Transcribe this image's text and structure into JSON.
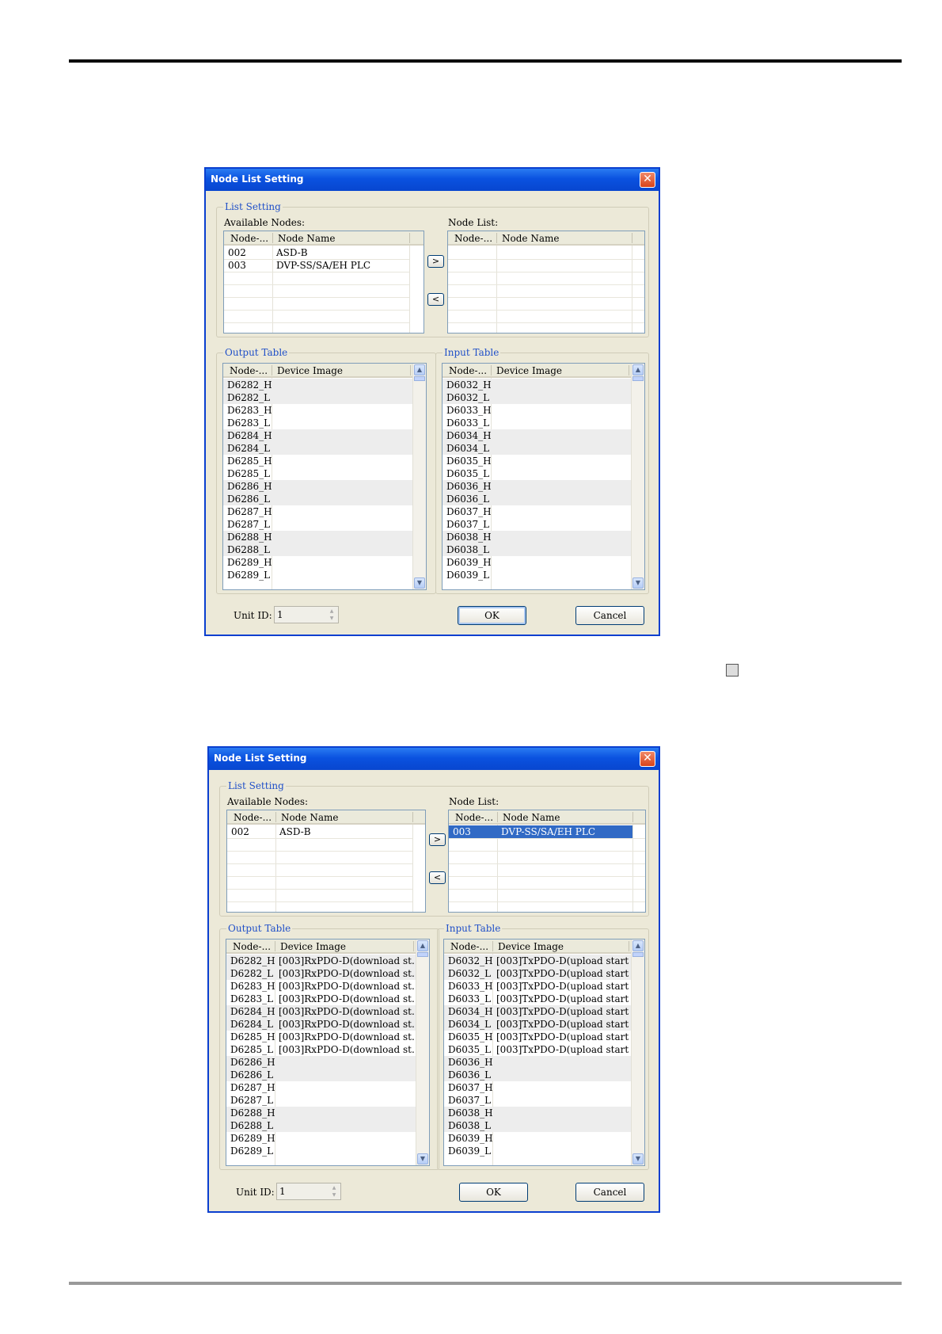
{
  "dialogs": [
    {
      "title": "Node List Setting",
      "group_list": "List Setting",
      "available_label": "Available Nodes:",
      "nodelist_label": "Node List:",
      "col_node": "Node-...",
      "col_name": "Node Name",
      "available_rows": [
        {
          "node": "002",
          "name": "ASD-B"
        },
        {
          "node": "003",
          "name": "DVP-SS/SA/EH PLC"
        }
      ],
      "node_list_rows": [],
      "move_right": ">",
      "move_left": "<",
      "output_table": {
        "label": "Output Table",
        "col_node": "Node-...",
        "col_image": "Device Image",
        "rows": [
          {
            "reg": "D6282_H",
            "image": ""
          },
          {
            "reg": "D6282_L",
            "image": ""
          },
          {
            "reg": "D6283_H",
            "image": ""
          },
          {
            "reg": "D6283_L",
            "image": ""
          },
          {
            "reg": "D6284_H",
            "image": ""
          },
          {
            "reg": "D6284_L",
            "image": ""
          },
          {
            "reg": "D6285_H",
            "image": ""
          },
          {
            "reg": "D6285_L",
            "image": ""
          },
          {
            "reg": "D6286_H",
            "image": ""
          },
          {
            "reg": "D6286_L",
            "image": ""
          },
          {
            "reg": "D6287_H",
            "image": ""
          },
          {
            "reg": "D6287_L",
            "image": ""
          },
          {
            "reg": "D6288_H",
            "image": ""
          },
          {
            "reg": "D6288_L",
            "image": ""
          },
          {
            "reg": "D6289_H",
            "image": ""
          },
          {
            "reg": "D6289_L",
            "image": ""
          }
        ]
      },
      "input_table": {
        "label": "Input Table",
        "col_node": "Node-...",
        "col_image": "Device Image",
        "rows": [
          {
            "reg": "D6032_H",
            "image": ""
          },
          {
            "reg": "D6032_L",
            "image": ""
          },
          {
            "reg": "D6033_H",
            "image": ""
          },
          {
            "reg": "D6033_L",
            "image": ""
          },
          {
            "reg": "D6034_H",
            "image": ""
          },
          {
            "reg": "D6034_L",
            "image": ""
          },
          {
            "reg": "D6035_H",
            "image": ""
          },
          {
            "reg": "D6035_L",
            "image": ""
          },
          {
            "reg": "D6036_H",
            "image": ""
          },
          {
            "reg": "D6036_L",
            "image": ""
          },
          {
            "reg": "D6037_H",
            "image": ""
          },
          {
            "reg": "D6037_L",
            "image": ""
          },
          {
            "reg": "D6038_H",
            "image": ""
          },
          {
            "reg": "D6038_L",
            "image": ""
          },
          {
            "reg": "D6039_H",
            "image": ""
          },
          {
            "reg": "D6039_L",
            "image": ""
          }
        ]
      },
      "unit_id_label": "Unit ID:",
      "unit_id_value": "1",
      "ok_label": "OK",
      "cancel_label": "Cancel"
    },
    {
      "title": "Node List Setting",
      "group_list": "List Setting",
      "available_label": "Available Nodes:",
      "nodelist_label": "Node List:",
      "col_node": "Node-...",
      "col_name": "Node Name",
      "available_rows": [
        {
          "node": "002",
          "name": "ASD-B"
        }
      ],
      "node_list_rows": [
        {
          "node": "003",
          "name": "DVP-SS/SA/EH PLC",
          "selected": true
        }
      ],
      "move_right": ">",
      "move_left": "<",
      "output_table": {
        "label": "Output Table",
        "col_node": "Node-...",
        "col_image": "Device Image",
        "rows": [
          {
            "reg": "D6282_H",
            "image": "[003]RxPDO-D(download st..."
          },
          {
            "reg": "D6282_L",
            "image": "[003]RxPDO-D(download st..."
          },
          {
            "reg": "D6283_H",
            "image": "[003]RxPDO-D(download st..."
          },
          {
            "reg": "D6283_L",
            "image": "[003]RxPDO-D(download st..."
          },
          {
            "reg": "D6284_H",
            "image": "[003]RxPDO-D(download st..."
          },
          {
            "reg": "D6284_L",
            "image": "[003]RxPDO-D(download st..."
          },
          {
            "reg": "D6285_H",
            "image": "[003]RxPDO-D(download st..."
          },
          {
            "reg": "D6285_L",
            "image": "[003]RxPDO-D(download st..."
          },
          {
            "reg": "D6286_H",
            "image": ""
          },
          {
            "reg": "D6286_L",
            "image": ""
          },
          {
            "reg": "D6287_H",
            "image": ""
          },
          {
            "reg": "D6287_L",
            "image": ""
          },
          {
            "reg": "D6288_H",
            "image": ""
          },
          {
            "reg": "D6288_L",
            "image": ""
          },
          {
            "reg": "D6289_H",
            "image": ""
          },
          {
            "reg": "D6289_L",
            "image": ""
          }
        ]
      },
      "input_table": {
        "label": "Input Table",
        "col_node": "Node-...",
        "col_image": "Device Image",
        "rows": [
          {
            "reg": "D6032_H",
            "image": "[003]TxPDO-D(upload start ..."
          },
          {
            "reg": "D6032_L",
            "image": "[003]TxPDO-D(upload start ..."
          },
          {
            "reg": "D6033_H",
            "image": "[003]TxPDO-D(upload start ..."
          },
          {
            "reg": "D6033_L",
            "image": "[003]TxPDO-D(upload start ..."
          },
          {
            "reg": "D6034_H",
            "image": "[003]TxPDO-D(upload start ..."
          },
          {
            "reg": "D6034_L",
            "image": "[003]TxPDO-D(upload start ..."
          },
          {
            "reg": "D6035_H",
            "image": "[003]TxPDO-D(upload start ..."
          },
          {
            "reg": "D6035_L",
            "image": "[003]TxPDO-D(upload start ..."
          },
          {
            "reg": "D6036_H",
            "image": ""
          },
          {
            "reg": "D6036_L",
            "image": ""
          },
          {
            "reg": "D6037_H",
            "image": ""
          },
          {
            "reg": "D6037_L",
            "image": ""
          },
          {
            "reg": "D6038_H",
            "image": ""
          },
          {
            "reg": "D6038_L",
            "image": ""
          },
          {
            "reg": "D6039_H",
            "image": ""
          },
          {
            "reg": "D6039_L",
            "image": ""
          }
        ]
      },
      "unit_id_label": "Unit ID:",
      "unit_id_value": "1",
      "ok_label": "OK",
      "cancel_label": "Cancel"
    }
  ]
}
